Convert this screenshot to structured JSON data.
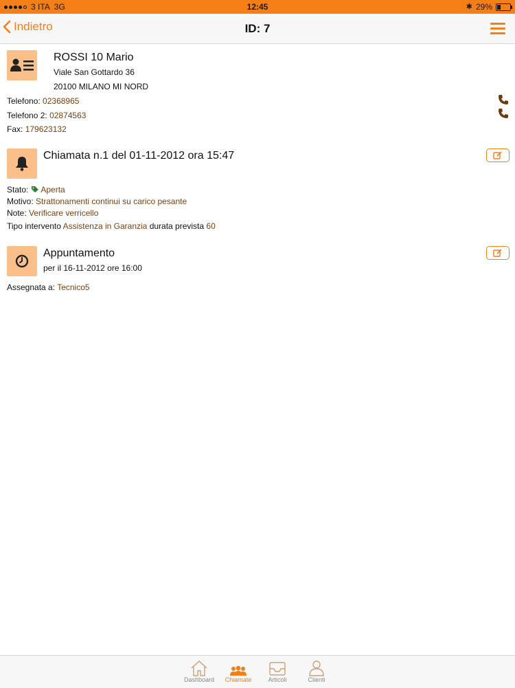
{
  "status_bar": {
    "carrier": "3 ITA",
    "network": "3G",
    "time": "12:45",
    "battery": "29%",
    "battery_level": 0.29
  },
  "nav": {
    "back_label": "Indietro",
    "title": "ID: 7",
    "accent_color": "#f57f17"
  },
  "customer": {
    "name": "ROSSI 10 Mario",
    "address_line1": "Viale San Gottardo  36",
    "address_line2": "20100  MILANO  MI  NORD",
    "phone_label": "Telefono:",
    "phone": "02368965",
    "phone2_label": "Telefono 2:",
    "phone2": "02874563",
    "fax_label": "Fax:",
    "fax": "179623132"
  },
  "call": {
    "title": "Chiamata n.1 del 01-11-2012 ora 15:47",
    "stato_label": "Stato:",
    "stato": "Aperta",
    "motivo_label": "Motivo:",
    "motivo": "Strattonamenti continui su carico pesante",
    "note_label": "Note:",
    "note": "Verificare verricello",
    "tipo_label": "Tipo intervento",
    "tipo": "Assistenza in Garanzia",
    "durata_label": "durata prevista",
    "durata": "60"
  },
  "appointment": {
    "title": "Appuntamento",
    "date": "per il 16-11-2012 ore 16:00",
    "assigned_label": "Assegnata a:",
    "assigned": "Tecnico5"
  },
  "tabs": [
    {
      "label": "Dashboard",
      "icon": "home-icon"
    },
    {
      "label": "Chiamate",
      "icon": "group-icon"
    },
    {
      "label": "Articoli",
      "icon": "inbox-icon"
    },
    {
      "label": "Clienti",
      "icon": "user-icon"
    }
  ]
}
